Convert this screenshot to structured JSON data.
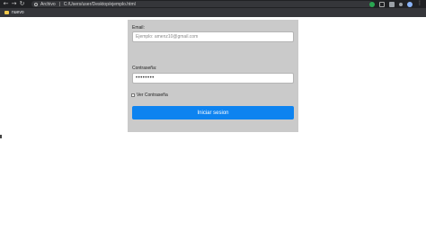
{
  "browser": {
    "nav": {
      "back": "←",
      "forward": "→",
      "reload": "↻"
    },
    "url_scheme": "Archivo",
    "url_path": "C:/Users/user/Desktop/ejemplo.html",
    "menu": "⋮"
  },
  "bookmarks": [
    {
      "label": "nuevo",
      "icon": "folder-icon"
    }
  ],
  "form": {
    "email_label": "Email:",
    "email_placeholder": "Ejemplo: amenz10@gmail.com",
    "password_label": "Contraseña:",
    "password_value": "••••••••",
    "show_password_label": "Ver Contraseña",
    "show_password_checked": false,
    "submit_label": "Iniciar sesion"
  },
  "colors": {
    "panel": "#cacaca",
    "submit": "#0d83f0",
    "browser_bar": "#202124"
  }
}
